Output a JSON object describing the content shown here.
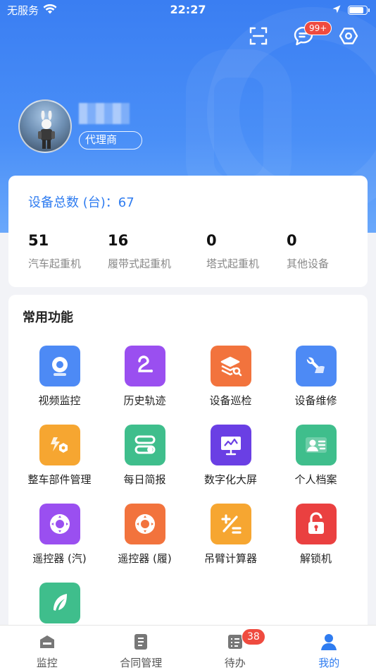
{
  "status_bar": {
    "carrier": "无服务",
    "time": "22:27",
    "battery_level": 0.85
  },
  "header": {
    "message_badge": "99+"
  },
  "profile": {
    "role": "代理商"
  },
  "device_summary": {
    "total_label": "设备总数 (台)：67",
    "stats": [
      {
        "value": "51",
        "label": "汽车起重机"
      },
      {
        "value": "16",
        "label": "履带式起重机"
      },
      {
        "value": "0",
        "label": "塔式起重机"
      },
      {
        "value": "0",
        "label": "其他设备"
      }
    ]
  },
  "functions": {
    "title": "常用功能",
    "items": [
      {
        "label": "视频监控",
        "icon": "camera-icon",
        "color": "#4d8af5"
      },
      {
        "label": "历史轨迹",
        "icon": "track-icon",
        "color": "#9a4ff0"
      },
      {
        "label": "设备巡检",
        "icon": "inspection-icon",
        "color": "#f2733d"
      },
      {
        "label": "设备维修",
        "icon": "repair-icon",
        "color": "#4d8af5"
      },
      {
        "label": "整车部件管理",
        "icon": "parts-icon",
        "color": "#f6a631"
      },
      {
        "label": "每日简报",
        "icon": "report-icon",
        "color": "#3fbe8c"
      },
      {
        "label": "数字化大屏",
        "icon": "screen-icon",
        "color": "#6a3fe4"
      },
      {
        "label": "个人档案",
        "icon": "profile-card-icon",
        "color": "#3fbe8c"
      },
      {
        "label": "遥控器 (汽)",
        "icon": "remote-icon",
        "color": "#9a4ff0"
      },
      {
        "label": "遥控器 (履)",
        "icon": "remote-icon",
        "color": "#f2733d"
      },
      {
        "label": "吊臂计算器",
        "icon": "calculator-icon",
        "color": "#f6a631"
      },
      {
        "label": "解锁机",
        "icon": "unlock-icon",
        "color": "#ea4040"
      },
      {
        "label": "",
        "icon": "feather-icon",
        "color": "#3fbe8c"
      }
    ]
  },
  "tabbar": {
    "tabs": [
      {
        "label": "监控",
        "icon": "monitor-icon"
      },
      {
        "label": "合同管理",
        "icon": "contract-icon"
      },
      {
        "label": "待办",
        "icon": "todo-icon",
        "badge": "38"
      },
      {
        "label": "我的",
        "icon": "user-icon",
        "active": true
      }
    ]
  }
}
